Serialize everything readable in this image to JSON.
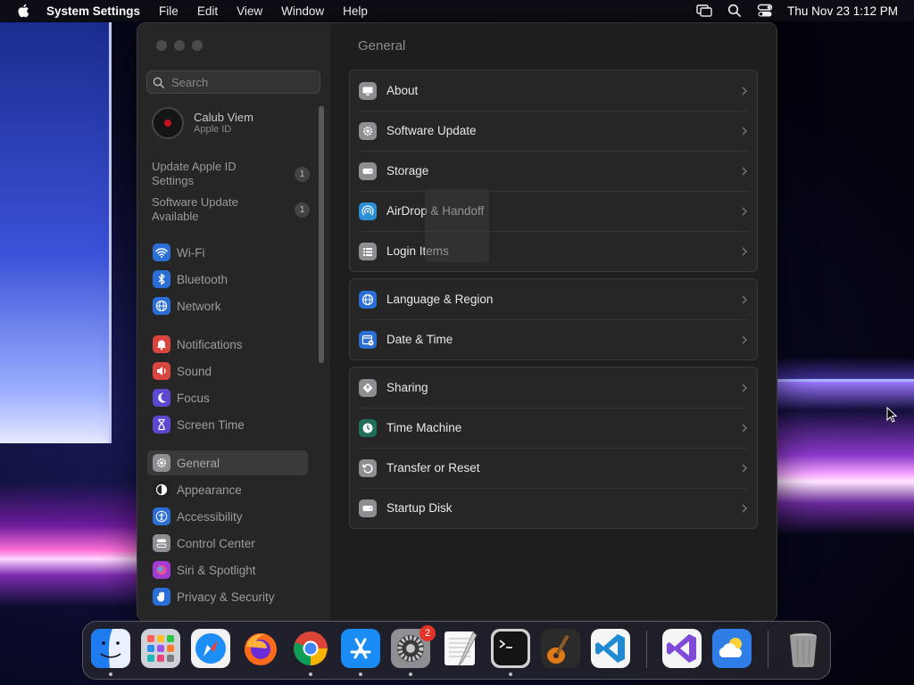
{
  "menubar": {
    "app_name": "System Settings",
    "menus": [
      "File",
      "Edit",
      "View",
      "Window",
      "Help"
    ],
    "clock": "Thu Nov 23  1:12 PM",
    "status_icons": [
      "screen-mirroring-icon",
      "spotlight-search-icon",
      "control-center-icon"
    ]
  },
  "sidebar": {
    "search_placeholder": "Search",
    "account": {
      "name": "Calub Viem",
      "subtitle": "Apple ID"
    },
    "notices": [
      {
        "label": "Update Apple ID Settings",
        "count": "1"
      },
      {
        "label": "Software Update Available",
        "count": "1"
      }
    ],
    "items": [
      {
        "label": "Wi-Fi",
        "icon": "wifi-icon",
        "color": "#2b6fd6"
      },
      {
        "label": "Bluetooth",
        "icon": "bluetooth-icon",
        "color": "#2b6fd6"
      },
      {
        "label": "Network",
        "icon": "globe-icon",
        "color": "#2b6fd6"
      },
      {
        "label": "Notifications",
        "icon": "bell-icon",
        "color": "#d8453f"
      },
      {
        "label": "Sound",
        "icon": "speaker-icon",
        "color": "#d8453f"
      },
      {
        "label": "Focus",
        "icon": "moon-icon",
        "color": "#5b4ad1"
      },
      {
        "label": "Screen Time",
        "icon": "hourglass-icon",
        "color": "#5b4ad1"
      },
      {
        "label": "General",
        "icon": "gear-icon",
        "color": "#8e8e93"
      },
      {
        "label": "Appearance",
        "icon": "appearance-icon",
        "color": "#222222"
      },
      {
        "label": "Accessibility",
        "icon": "accessibility-icon",
        "color": "#2b6fd6"
      },
      {
        "label": "Control Center",
        "icon": "control-center-icon",
        "color": "#8e8e93"
      },
      {
        "label": "Siri & Spotlight",
        "icon": "siri-icon",
        "color": "#a23bd1"
      },
      {
        "label": "Privacy & Security",
        "icon": "hand-icon",
        "color": "#2b6fd6"
      }
    ]
  },
  "main": {
    "title": "General",
    "groups": [
      [
        {
          "label": "About",
          "icon": "display-icon"
        },
        {
          "label": "Software Update",
          "icon": "gear-badge-icon"
        },
        {
          "label": "Storage",
          "icon": "drive-icon"
        },
        {
          "label": "AirDrop & Handoff",
          "icon": "airdrop-icon"
        },
        {
          "label": "Login Items",
          "icon": "list-icon"
        }
      ],
      [
        {
          "label": "Language & Region",
          "icon": "globe-icon"
        },
        {
          "label": "Date & Time",
          "icon": "calendar-clock-icon"
        }
      ],
      [
        {
          "label": "Sharing",
          "icon": "sharing-icon"
        },
        {
          "label": "Time Machine",
          "icon": "time-machine-icon"
        },
        {
          "label": "Transfer or Reset",
          "icon": "reset-icon"
        },
        {
          "label": "Startup Disk",
          "icon": "drive-icon"
        }
      ]
    ]
  },
  "dock": {
    "apps": [
      {
        "name": "Finder",
        "icon": "finder-icon",
        "running": true
      },
      {
        "name": "Launchpad",
        "icon": "launchpad-icon",
        "running": false
      },
      {
        "name": "Safari",
        "icon": "safari-icon",
        "running": false
      },
      {
        "name": "Firefox",
        "icon": "firefox-icon",
        "running": false
      },
      {
        "name": "Chrome",
        "icon": "chrome-icon",
        "running": true
      },
      {
        "name": "App Store",
        "icon": "app-store-icon",
        "running": true
      },
      {
        "name": "System Settings",
        "icon": "system-settings-icon",
        "running": true,
        "badge": "2"
      },
      {
        "name": "TextEdit",
        "icon": "textedit-icon",
        "running": false
      },
      {
        "name": "Terminal",
        "icon": "terminal-icon",
        "running": true
      },
      {
        "name": "GarageBand",
        "icon": "garageband-icon",
        "running": false
      },
      {
        "name": "Visual Studio Code",
        "icon": "vscode-icon",
        "running": false
      },
      {
        "name": "Visual Studio",
        "icon": "visual-studio-icon",
        "running": false
      },
      {
        "name": "Weather",
        "icon": "weather-icon",
        "running": false
      },
      {
        "name": "Trash",
        "icon": "trash-icon",
        "running": false
      }
    ]
  }
}
